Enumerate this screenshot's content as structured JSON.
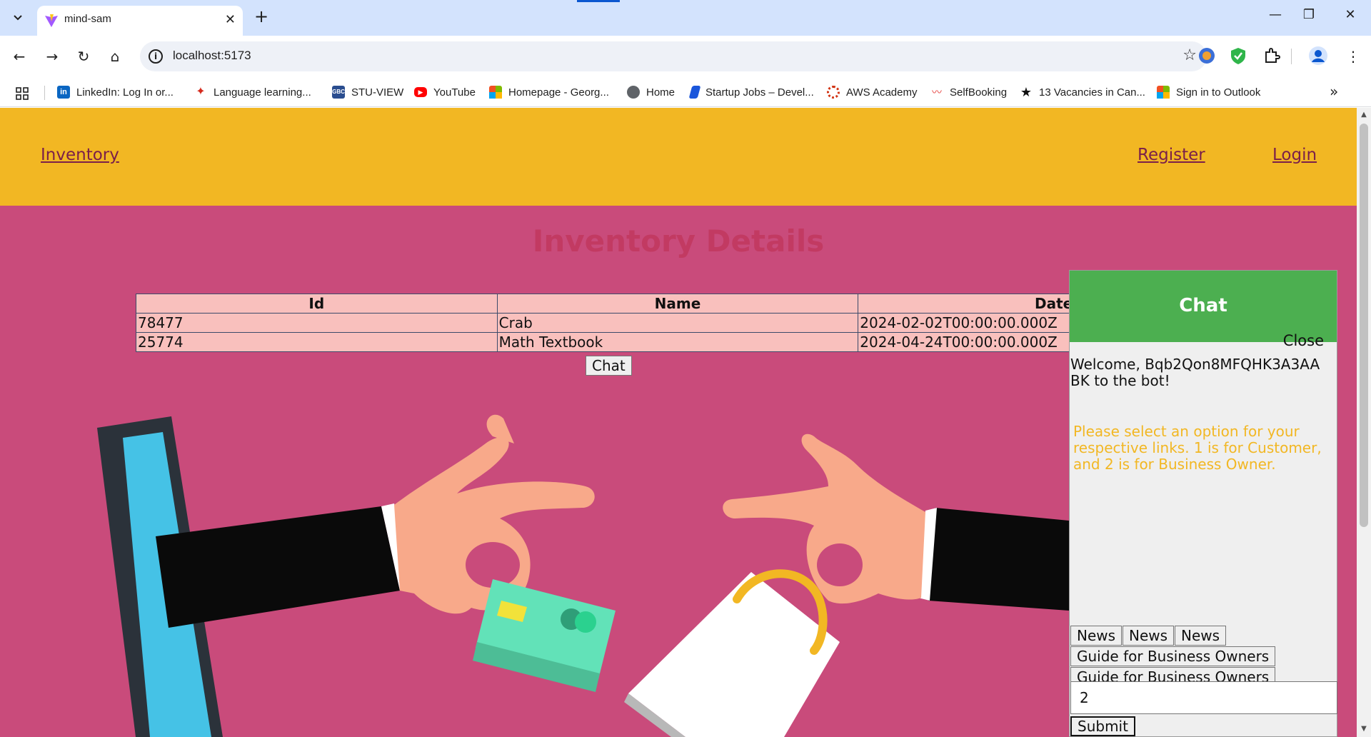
{
  "browser": {
    "tab_title": "mind-sam",
    "url": "localhost:5173",
    "bookmarks": [
      {
        "label": "LinkedIn: Log In or...",
        "icon": "linkedin-icon",
        "color": "#0a66c2"
      },
      {
        "label": "Language learning...",
        "icon": "maple-leaf-icon",
        "color": "#d52b1e"
      },
      {
        "label": "STU-VIEW",
        "icon": "gbc-icon",
        "color": "#2a4d8f"
      },
      {
        "label": "YouTube",
        "icon": "youtube-icon",
        "color": "#ff0000"
      },
      {
        "label": "Homepage - Georg...",
        "icon": "microsoft-icon",
        "color": "#f25022"
      },
      {
        "label": "Home",
        "icon": "globe-icon",
        "color": "#5f6368"
      },
      {
        "label": "Startup Jobs – Devel...",
        "icon": "startup-icon",
        "color": "#1a56db"
      },
      {
        "label": "AWS Academy",
        "icon": "aws-icon",
        "color": "#d13212"
      },
      {
        "label": "SelfBooking",
        "icon": "selfbooking-icon",
        "color": "#e53935"
      },
      {
        "label": "13 Vacancies in Can...",
        "icon": "star-icon",
        "color": "#111111"
      },
      {
        "label": "Sign in to Outlook",
        "icon": "microsoft-icon",
        "color": "#f25022"
      }
    ]
  },
  "header": {
    "inventory_link": "Inventory",
    "register_link": "Register",
    "login_link": "Login"
  },
  "main": {
    "title": "Inventory Details",
    "table": {
      "headers": [
        "Id",
        "Name",
        "Date"
      ],
      "rows": [
        [
          "78477",
          "Crab",
          "2024-02-02T00:00:00.000Z"
        ],
        [
          "25774",
          "Math Textbook",
          "2024-04-24T00:00:00.000Z"
        ]
      ]
    },
    "chat_button": "Chat"
  },
  "chat": {
    "title": "Chat",
    "close_label": "Close",
    "welcome": "Welcome, Bqb2Qon8MFQHK3A3AABK to the bot!",
    "prompt": "Please select an option for your respective links. 1 is for Customer, and 2 is for Business Owner.",
    "news_buttons": [
      "News",
      "News",
      "News"
    ],
    "guide_buttons": [
      "Guide for Business Owners",
      "Guide for Business Owners"
    ],
    "input_value": "2",
    "submit_label": "Submit"
  },
  "colors": {
    "header_bg": "#f2b723",
    "page_bg": "#c94b7b",
    "title_color": "#c23a62",
    "chat_header": "#4caf50",
    "prompt_color": "#f2b723",
    "table_bg": "#f9c0bd"
  }
}
